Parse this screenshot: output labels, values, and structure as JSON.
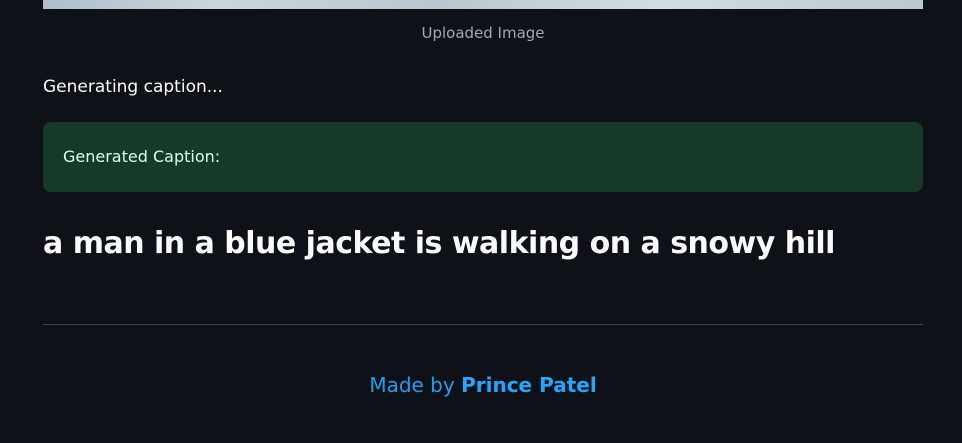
{
  "image": {
    "caption": "Uploaded Image"
  },
  "status": {
    "text": "Generating caption..."
  },
  "result_box": {
    "label": "Generated Caption:"
  },
  "caption": {
    "text": "a man in a blue jacket is walking on a snowy hill"
  },
  "footer": {
    "prefix": "Made by ",
    "author": "Prince Patel"
  },
  "colors": {
    "background": "#0e1117",
    "success_bg": "#173928",
    "link": "#1ea0f0"
  }
}
